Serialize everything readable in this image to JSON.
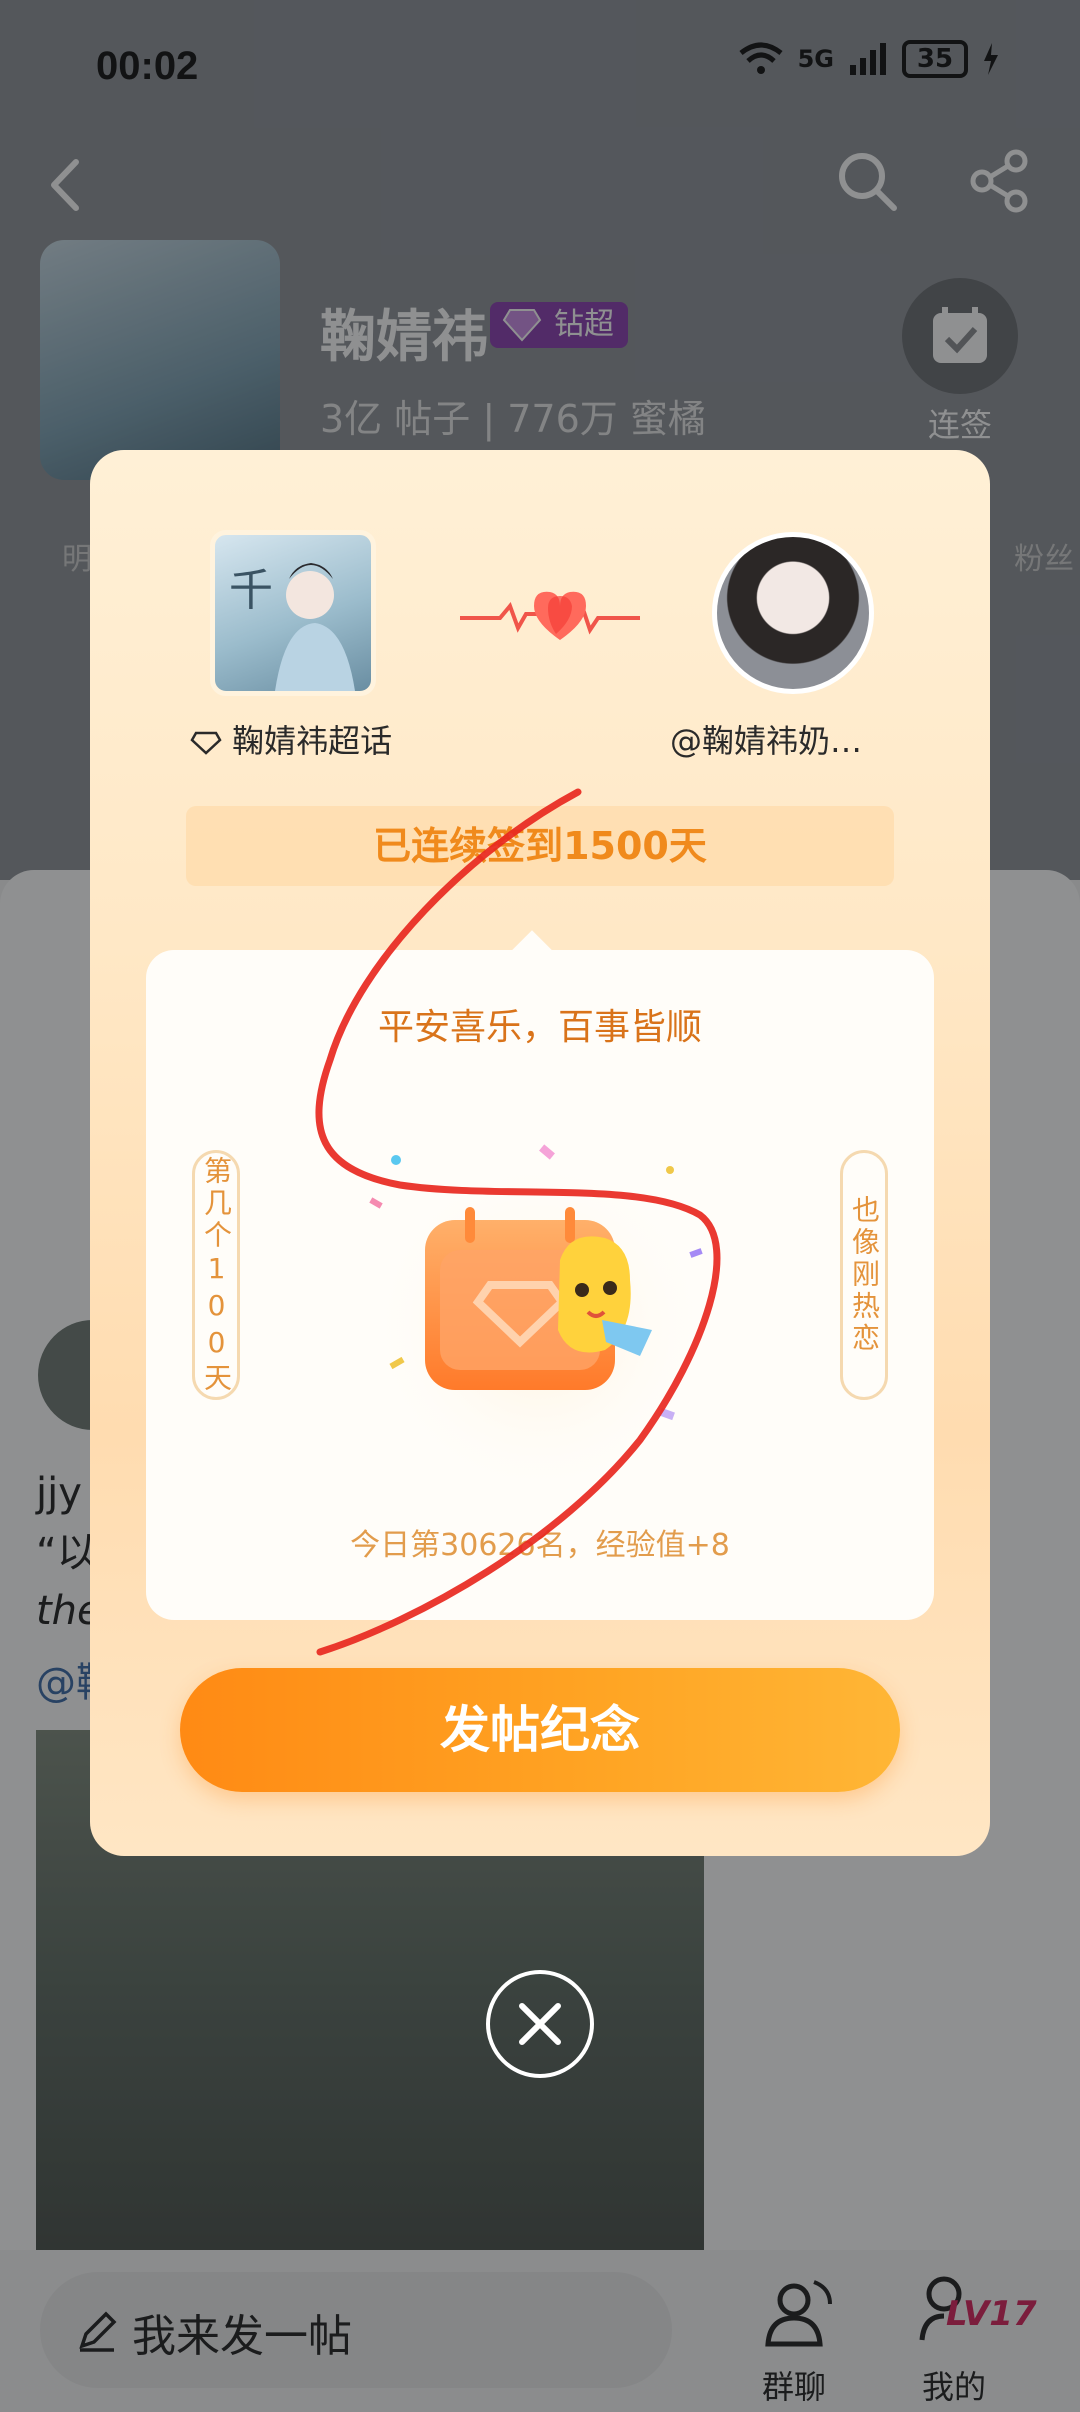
{
  "status_bar": {
    "time": "00:02",
    "network": "5G",
    "battery": "35"
  },
  "topic": {
    "name": "鞠婧祎",
    "badge": "钻超",
    "stats": "3亿 帖子 | 776万 蜜橘",
    "checkin_label": "连签",
    "checkin_days_suffix": "天",
    "side_left": "明",
    "side_right": "粉丝"
  },
  "post": {
    "line1": "jjy",
    "line2": "“以",
    "line3": "the",
    "line4": "@鞠"
  },
  "compose": {
    "placeholder": "我来发一帖"
  },
  "bottom_nav": {
    "chat_label": "群聊",
    "me_label": "我的",
    "level": "LV17"
  },
  "modal": {
    "topic_label": "鞠婧祎超话",
    "user_label": "@鞠婧祎奶…",
    "streak": "已连续签到1500天",
    "blessing": "平安喜乐，百事皆顺",
    "left_vertical": "第几个100天",
    "right_vertical": "也像刚热恋",
    "rank": "今日第30626名，经验值+8",
    "post_button": "发帖纪念"
  },
  "colors": {
    "accent_orange": "#ff8a14",
    "streak_text": "#f08a1c",
    "scribble_red": "#e8281f",
    "badge_purple": "#8a3fb0"
  },
  "icons": [
    "back-icon",
    "search-icon",
    "share-icon",
    "calendar-check-icon",
    "diamond-icon",
    "heart-pulse-icon",
    "pencil-icon",
    "group-chat-icon",
    "profile-icon",
    "close-icon"
  ]
}
